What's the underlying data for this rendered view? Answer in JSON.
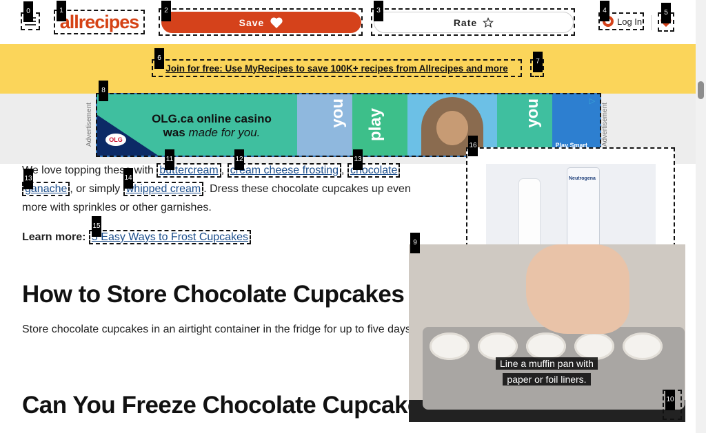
{
  "header": {
    "logo_text": "allrecipes",
    "save_label": "Save",
    "rate_label": "Rate",
    "login_label": "Log In"
  },
  "promo": {
    "text": "Join for free: Use MyRecipes to save 100K+ recipes from Allrecipes and more"
  },
  "ad_banner": {
    "label": "Advertisement",
    "headline_1": "OLG.ca online casino",
    "headline_2_a": "was ",
    "headline_2_b": "made for you.",
    "badge": "OLG",
    "word_you": "you",
    "word_play": "play",
    "footer": "Play Smart"
  },
  "article": {
    "p1_start": "We love topping these with ",
    "link_buttercream": "buttercream",
    "link_cream_cheese": "cream cheese frosting",
    "link_chocolate": "chocolate",
    "link_ganache": "ganache",
    "p1_mid": ", or simply ",
    "link_whipped": "whipped cream",
    "p1_end": ". Dress these chocolate cupcakes up even more with sprinkles or other garnishes.",
    "learn_more_label": "Learn more:",
    "learn_more_link": "5 Easy Ways to Frost Cupcakes",
    "h2_store": "How to Store Chocolate Cupcakes",
    "store_text": "Store chocolate cupcakes in an airtight container in the fridge for up to five days.",
    "h2_freeze": "Can You Freeze Chocolate Cupcakes?"
  },
  "video": {
    "caption_1": "Line a muffin pan with",
    "caption_2": "paper or foil liners."
  },
  "tags": [
    "0",
    "1",
    "2",
    "3",
    "4",
    "5",
    "6",
    "7",
    "8",
    "9",
    "10",
    "11",
    "12",
    "13",
    "13",
    "14",
    "15",
    "16"
  ],
  "colors": {
    "brand": "#d54215",
    "promo_bg": "#fbd55a",
    "link": "#1a4c8a"
  }
}
